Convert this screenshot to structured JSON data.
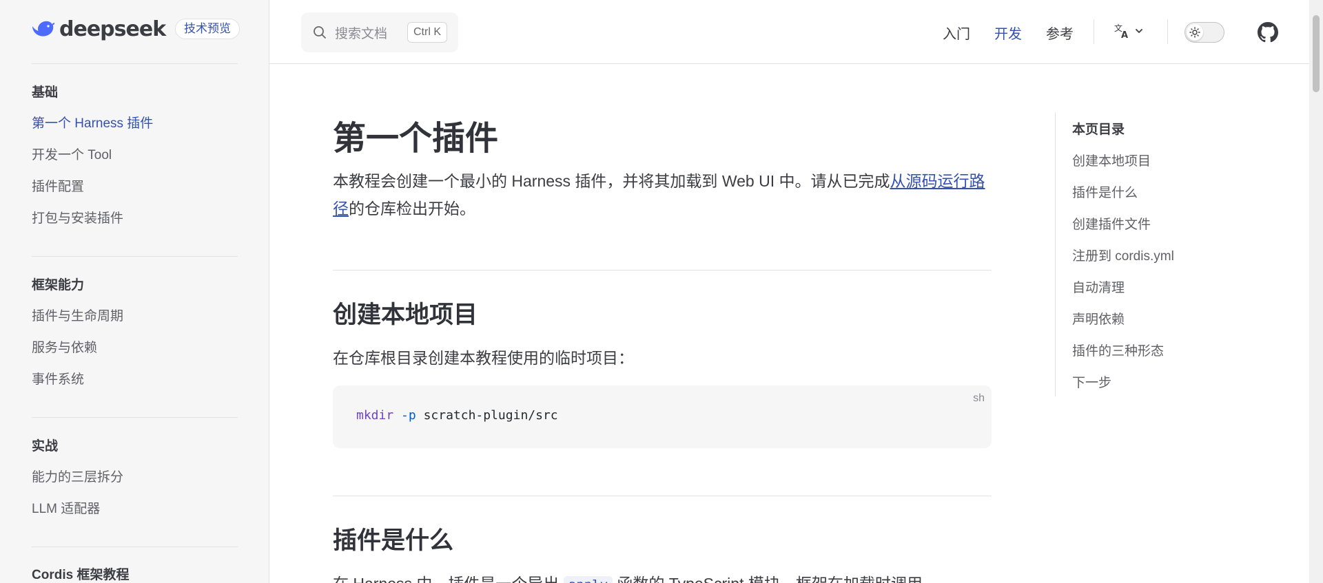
{
  "brand": {
    "name": "deepseek",
    "badge": "技术预览"
  },
  "sidebar": {
    "groups": [
      {
        "title": "基础",
        "items": [
          "第一个 Harness 插件",
          "开发一个 Tool",
          "插件配置",
          "打包与安装插件"
        ]
      },
      {
        "title": "框架能力",
        "items": [
          "插件与生命周期",
          "服务与依赖",
          "事件系统"
        ]
      },
      {
        "title": "实战",
        "items": [
          "能力的三层拆分",
          "LLM 适配器"
        ]
      },
      {
        "title": "Cordis 框架教程",
        "items": []
      }
    ],
    "active_item": "第一个 Harness 插件"
  },
  "search": {
    "label": "搜索文档",
    "shortcut": "Ctrl K"
  },
  "nav": {
    "items": [
      "入门",
      "开发",
      "参考"
    ],
    "active": "开发"
  },
  "toolbar": {
    "language_icon": "translate-icon",
    "theme_icon": "sun-icon",
    "github_icon": "github-icon"
  },
  "page": {
    "title": "第一个插件",
    "intro_before": "本教程会创建一个最小的 Harness 插件，并将其加载到 Web UI 中。请从已完成",
    "intro_link": "从源码运行路径",
    "intro_after": "的仓库检出开始。",
    "section1": {
      "title": "创建本地项目",
      "text": "在仓库根目录创建本教程使用的临时项目：",
      "code_lang": "sh",
      "code_cmd": "mkdir",
      "code_flag": "-p",
      "code_arg": "scratch-plugin/src"
    },
    "section2": {
      "title": "插件是什么",
      "text_before": "在 Harness 中，插件是一个导出",
      "inline_code": "apply",
      "text_after": "函数的 TypeScript 模块，框架在加载时调用"
    }
  },
  "toc": {
    "title": "本页目录",
    "items": [
      "创建本地项目",
      "插件是什么",
      "创建插件文件",
      "注册到 cordis.yml",
      "自动清理",
      "声明依赖",
      "插件的三种形态",
      "下一步"
    ]
  },
  "colors": {
    "accent": "#3451b2",
    "sidebar_bg": "#f6f6f7",
    "border": "#e2e2e3"
  }
}
